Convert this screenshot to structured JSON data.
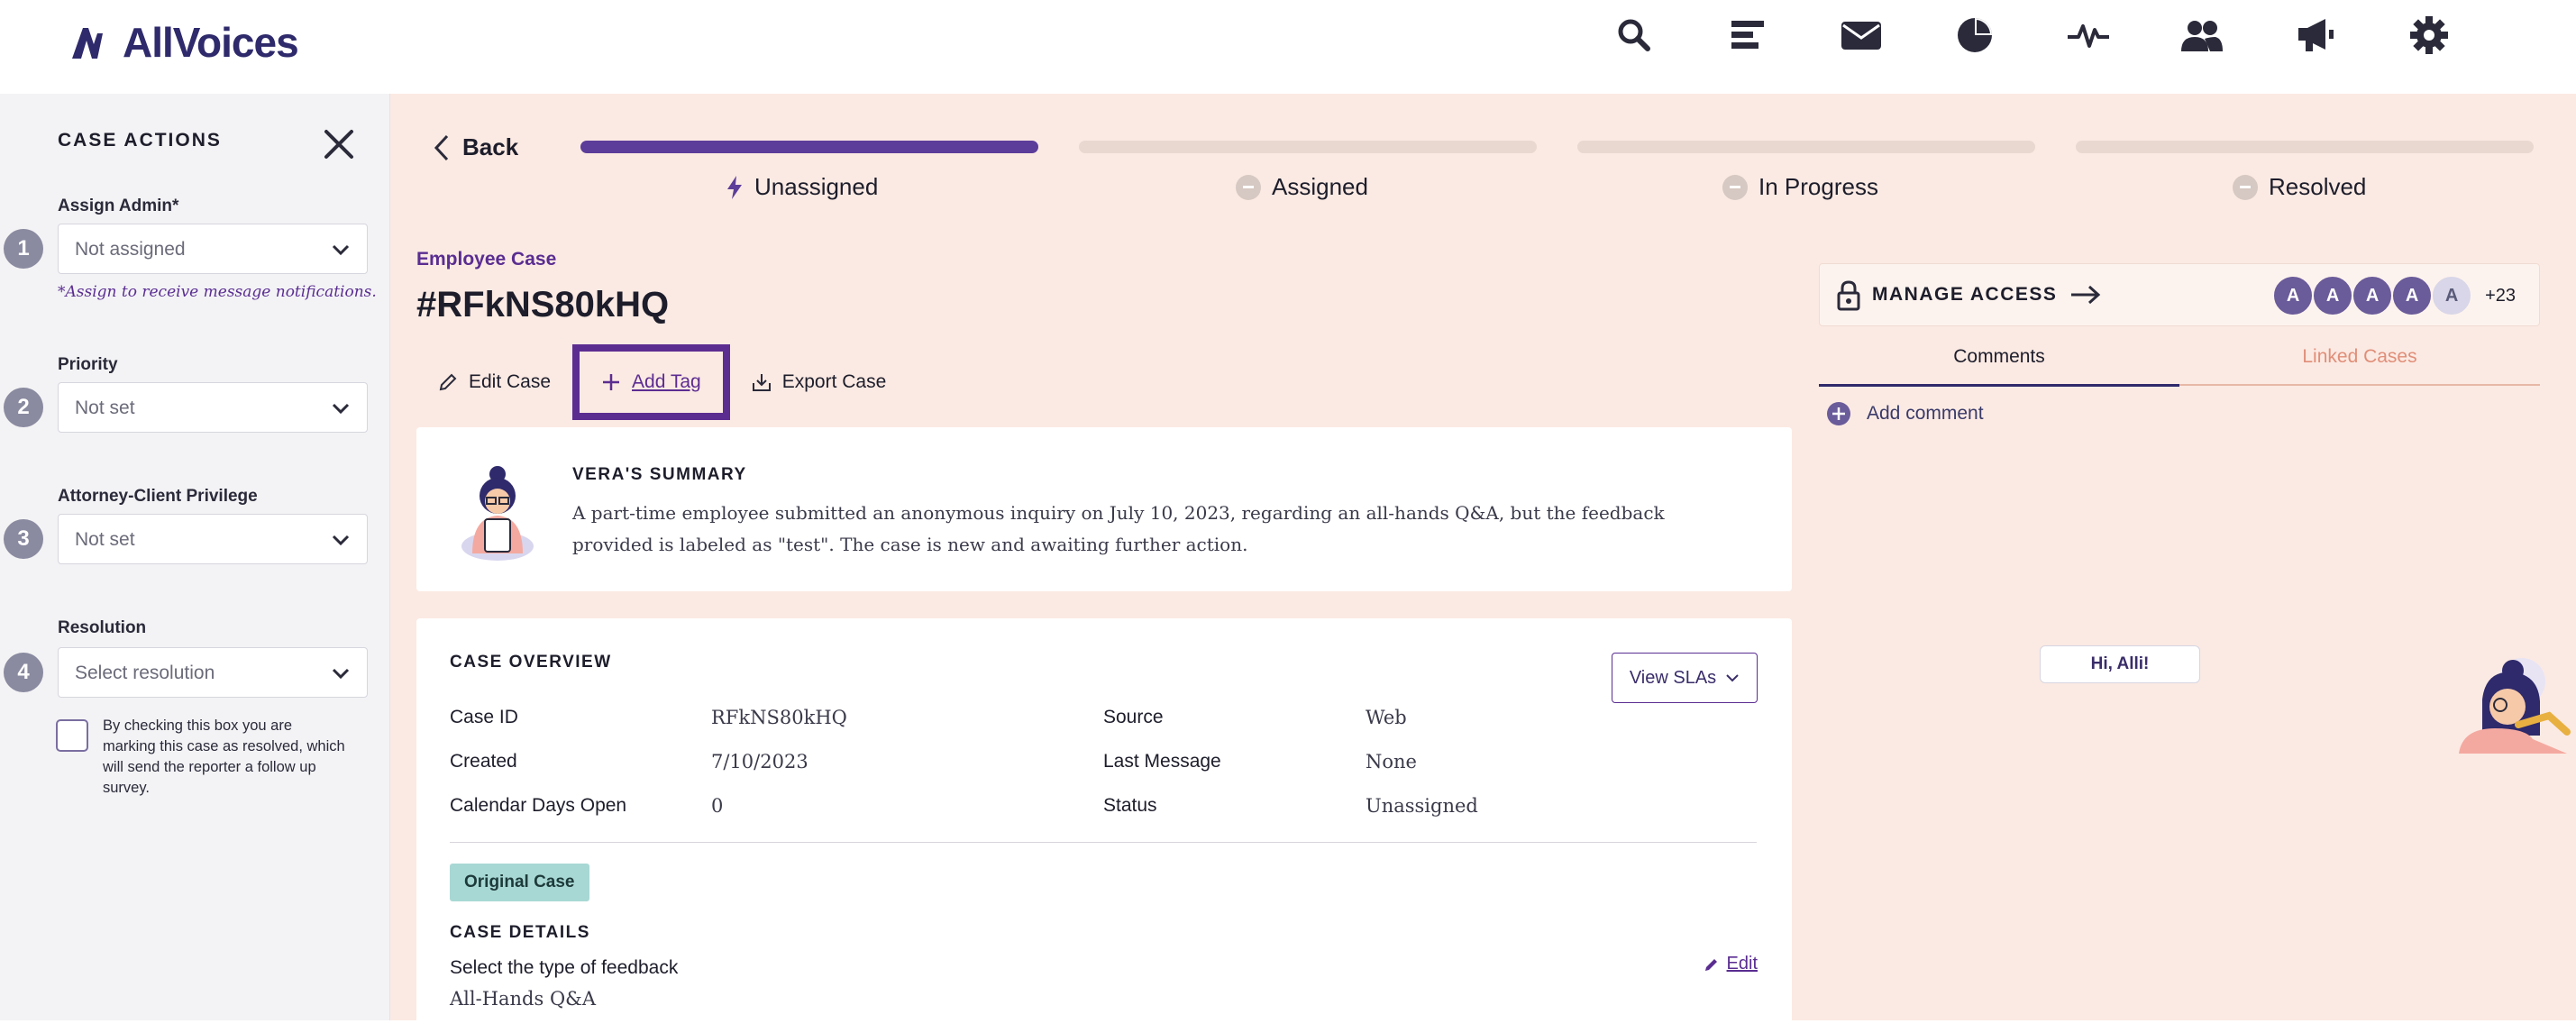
{
  "brand": {
    "name": "AllVoices"
  },
  "top_nav": [
    {
      "icon": "search-icon"
    },
    {
      "icon": "bar-list-icon"
    },
    {
      "icon": "mail-icon"
    },
    {
      "icon": "pie-chart-icon"
    },
    {
      "icon": "pulse-icon"
    },
    {
      "icon": "users-icon"
    },
    {
      "icon": "megaphone-icon"
    },
    {
      "icon": "gear-icon"
    }
  ],
  "sidebar": {
    "title": "CASE ACTIONS",
    "fields": [
      {
        "num": "1",
        "label": "Assign Admin*",
        "value": "Not assigned",
        "hint": "*Assign to receive message notifications."
      },
      {
        "num": "2",
        "label": "Priority",
        "value": "Not set"
      },
      {
        "num": "3",
        "label": "Attorney-Client Privilege",
        "value": "Not set"
      },
      {
        "num": "4",
        "label": "Resolution",
        "value": "Select resolution"
      }
    ],
    "resolve_checkbox_text": "By checking this box you are marking this case as resolved, which will send the reporter a follow up survey."
  },
  "header": {
    "back_label": "Back",
    "steps": [
      {
        "label": "Unassigned",
        "active": true
      },
      {
        "label": "Assigned",
        "active": false
      },
      {
        "label": "In Progress",
        "active": false
      },
      {
        "label": "Resolved",
        "active": false
      }
    ]
  },
  "case": {
    "type": "Employee Case",
    "id": "#RFkNS80kHQ",
    "actions": {
      "edit": "Edit Case",
      "add_tag": "Add Tag",
      "export": "Export Case"
    }
  },
  "summary": {
    "title": "VERA'S SUMMARY",
    "text": "A part-time employee submitted an anonymous inquiry on July 10, 2023, regarding an all-hands Q&A, but the feedback provided is labeled as \"test\". The case is new and awaiting further action."
  },
  "overview": {
    "title": "CASE OVERVIEW",
    "view_slas": "View SLAs",
    "left": [
      {
        "label": "Case ID",
        "value": "RFkNS80kHQ"
      },
      {
        "label": "Created",
        "value": "7/10/2023"
      },
      {
        "label": "Calendar Days Open",
        "value": "0"
      }
    ],
    "right": [
      {
        "label": "Source",
        "value": "Web"
      },
      {
        "label": "Last Message",
        "value": "None"
      },
      {
        "label": "Status",
        "value": "Unassigned"
      }
    ],
    "badge": "Original Case",
    "details_title": "CASE DETAILS",
    "question": "Select the type of feedback",
    "answer": "All-Hands Q&A",
    "edit_label": "Edit"
  },
  "access": {
    "label": "MANAGE ACCESS",
    "avatars": [
      "A",
      "A",
      "A",
      "A",
      "A"
    ],
    "more": "+23"
  },
  "tabs": {
    "comments": "Comments",
    "linked": "Linked Cases"
  },
  "add_comment": "Add comment",
  "assistant": {
    "greeting": "Hi, Alli!"
  },
  "colors": {
    "accent": "#5c2d91",
    "main_bg": "#fbeae3",
    "sidebar_bg": "#f3f3f5"
  }
}
